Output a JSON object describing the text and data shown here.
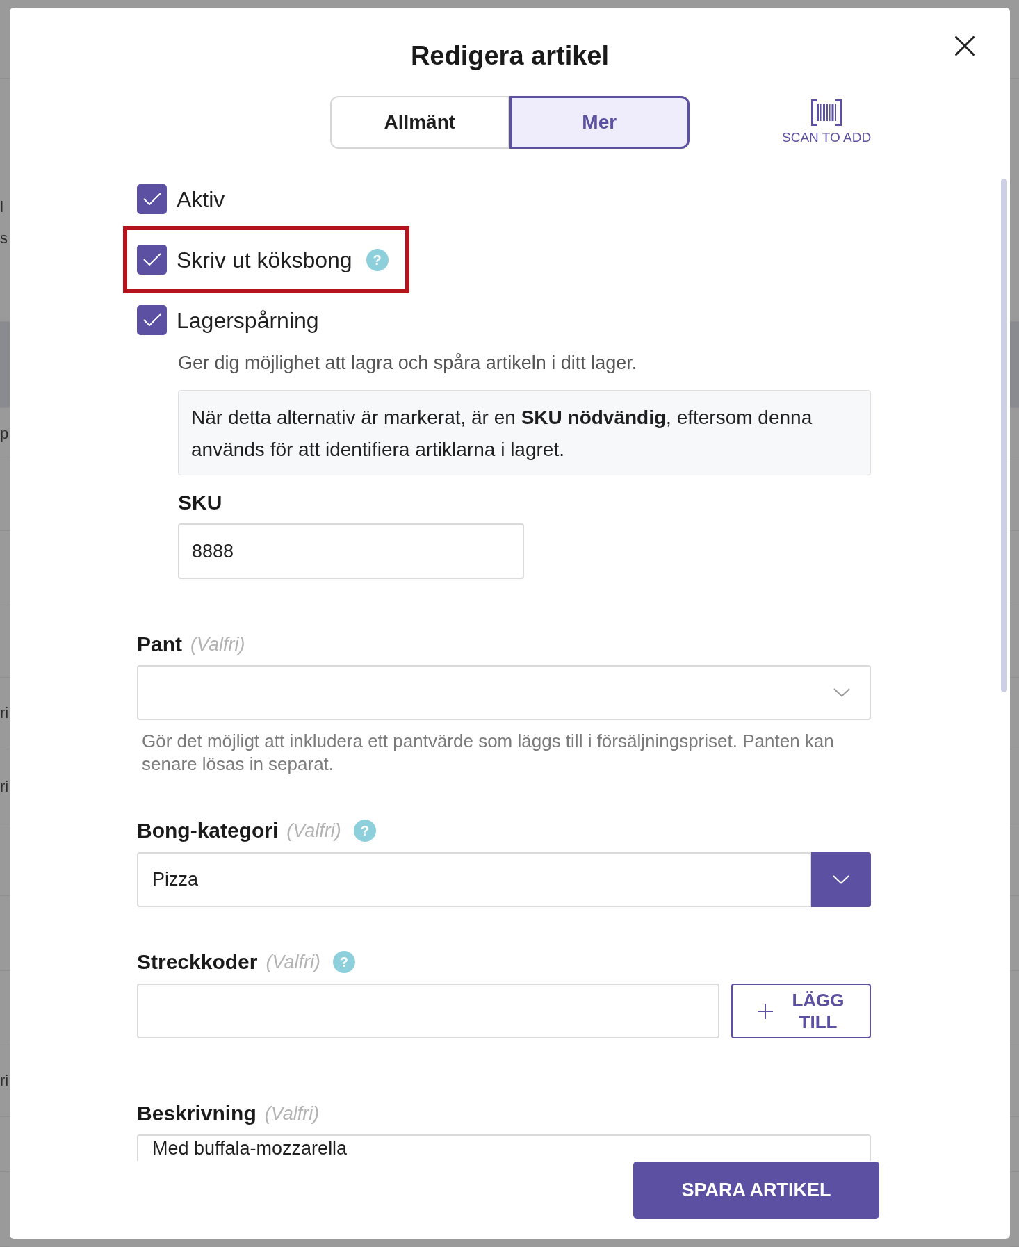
{
  "background_page": {
    "rows": [
      {
        "selected": false,
        "fragments": [
          "l",
          "s"
        ]
      },
      {
        "selected": true
      },
      {
        "selected": false,
        "fragments": [
          "p"
        ]
      },
      {
        "selected": false
      },
      {
        "selected": false
      },
      {
        "selected": false
      },
      {
        "selected": false,
        "fragments": [
          "ri"
        ]
      },
      {
        "selected": false,
        "fragments": [
          "ri"
        ]
      },
      {
        "selected": false
      },
      {
        "selected": false
      },
      {
        "selected": false
      },
      {
        "selected": false,
        "fragments": [
          "ri"
        ]
      },
      {
        "selected": false
      },
      {
        "selected": false
      }
    ]
  },
  "dialog": {
    "title": "Redigera artikel"
  },
  "tabs": [
    {
      "label": "Allmänt",
      "selected": false
    },
    {
      "label": "Mer",
      "selected": true
    }
  ],
  "scan_button": {
    "label": "SCAN TO ADD"
  },
  "options": [
    {
      "label": "Aktiv",
      "checked": true,
      "highlighted": false
    },
    {
      "label": "Skriv ut köksbong",
      "checked": true,
      "highlighted": true,
      "help": "?"
    },
    {
      "label": "Lagerspårning",
      "checked": true,
      "highlighted": false
    }
  ],
  "inventory": {
    "description": "Ger dig möjlighet att lagra och spåra artikeln i ditt lager.",
    "notice": "När detta alternativ är markerat, är en **SKU nödvändig**, eftersom denna används för att identifiera artiklarna i lagret.",
    "sku": {
      "label": "SKU",
      "value": "8888"
    }
  },
  "fields": [
    {
      "kind": "select",
      "label": "Pant",
      "optional": "(Valfri)",
      "hint": "Gör det möjligt att inkludera ett pantvärde som läggs till i försäljningspriset. Panten kan senare lösas in separat."
    },
    {
      "kind": "select_button",
      "label": "Bong-kategori",
      "optional": "(Valfri)",
      "help": "?",
      "value": "Pizza"
    },
    {
      "kind": "input_add",
      "label": "Streckkoder",
      "optional": "(Valfri)",
      "help": "?",
      "button": "LÄGG TILL"
    },
    {
      "kind": "textarea",
      "label": "Beskrivning",
      "optional": "(Valfri)",
      "value": "Med buffala-mozzarella"
    }
  ],
  "footer": {
    "save_button": "SPARA ARTIKEL"
  }
}
